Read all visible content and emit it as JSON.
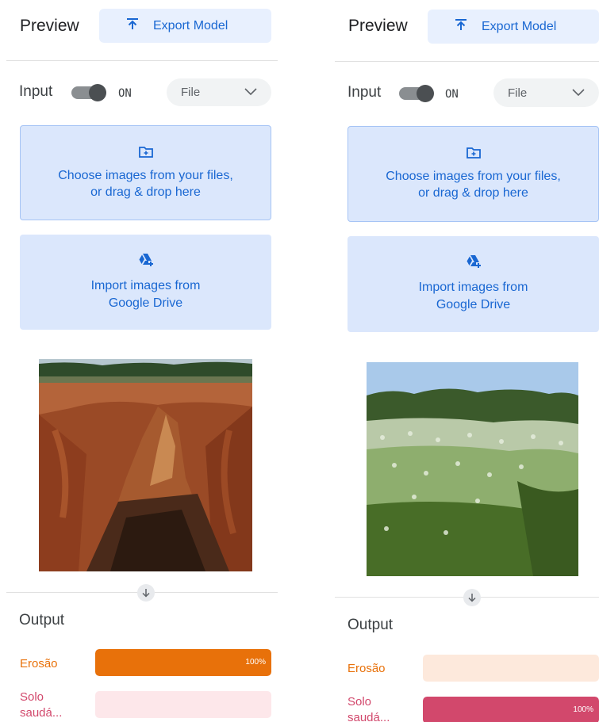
{
  "panels": [
    {
      "header": {
        "title": "Preview",
        "export_label": "Export Model"
      },
      "input": {
        "label": "Input",
        "toggle_state": "ON",
        "source": "File"
      },
      "upload": {
        "line1": "Choose images from your files,",
        "line2": "or drag & drop here"
      },
      "drive": {
        "line1": "Import images from",
        "line2": "Google Drive"
      },
      "image": "eroded red soil gully",
      "output": {
        "label": "Output",
        "classes": [
          {
            "label": "Erosão",
            "line2": "",
            "confidence": 1.0,
            "percent": "100%",
            "color": "#e8710a",
            "track": "#fde9dc"
          },
          {
            "label": "Solo",
            "line2": "saudá...",
            "confidence": 0.0,
            "percent": "",
            "color": "#d2486c",
            "track": "#fde7ea"
          }
        ]
      }
    },
    {
      "header": {
        "title": "Preview",
        "export_label": "Export Model"
      },
      "input": {
        "label": "Input",
        "toggle_state": "ON",
        "source": "File"
      },
      "upload": {
        "line1": "Choose images from your files,",
        "line2": "or drag & drop here"
      },
      "drive": {
        "line1": "Import images from",
        "line2": "Google Drive"
      },
      "image": "flowering vegetation field",
      "output": {
        "label": "Output",
        "classes": [
          {
            "label": "Erosão",
            "line2": "",
            "confidence": 0.0,
            "percent": "",
            "color": "#e8710a",
            "track": "#fde9dc"
          },
          {
            "label": "Solo",
            "line2": "saudá...",
            "confidence": 1.0,
            "percent": "100%",
            "color": "#d2486c",
            "track": "#fde7ea"
          }
        ]
      }
    }
  ],
  "icons": {
    "export": "upload-arrow-icon",
    "chevron": "chevron-down-icon",
    "folder": "folder-add-icon",
    "drive": "google-drive-add-icon",
    "arrow": "arrow-down-icon"
  }
}
